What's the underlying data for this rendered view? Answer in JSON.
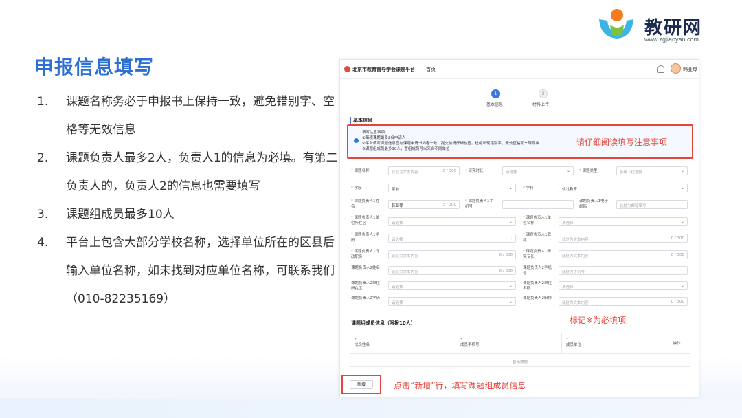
{
  "logo": {
    "name": "教研网",
    "url": "www.zgjiaoyan.com"
  },
  "page_title": "申报信息填写",
  "instructions": [
    {
      "num": "1.",
      "text": "课题名称务必于申报书上保持一致，避免错别字、空格等无效信息"
    },
    {
      "num": "2.",
      "text": "课题负责人最多2人，负责人1的信息为必填。有第二负责人的，负责人2的信息也需要填写"
    },
    {
      "num": "3.",
      "text": "课题组成员最多10人"
    },
    {
      "num": "4.",
      "text": "平台上包含大部分学校名称，选择单位所在的区县后输入单位名称，如未找到对应单位名称，可联系我们（010-82235169）"
    }
  ],
  "app": {
    "brand": "北京市教育督导学会课题平台",
    "nav_home": "首页",
    "user_name": "韩亚琴",
    "steps": [
      {
        "num": "1",
        "label": "基本信息"
      },
      {
        "num": "2",
        "label": "材料上传"
      }
    ],
    "section_title": "基本信息",
    "notice": {
      "heading": "填写注意事项:",
      "lines": [
        "①每项课题最多2名申请人",
        "②平台填写课题信息应与课题申请书内容一致，提交前请仔细核查，杜绝出现错别字、无效空格而车等现象",
        "③课题组成员最多10人，暂组成员可以来自不同单位"
      ],
      "callout": "请仔细阅读填写注意事项"
    },
    "form": {
      "r1": {
        "name_label": "课题名称",
        "name_ph": "此处为文本内容",
        "name_count": "0 / 300",
        "period_label": "研究时长",
        "period_ph": "请选择",
        "type_label": "课题类型",
        "type_ph": "多级下拉选择"
      },
      "r2": {
        "stage_label": "学段",
        "stage_val": "学前",
        "subject_label": "学科",
        "subject_val": "幼儿教育"
      },
      "r3": {
        "l1_label": "课题负责人1姓名",
        "l1_val": "韩亚琴",
        "l1_count": "3 / 300",
        "phone_label": "课题负责人1手机号",
        "email_label": "课题负责人1电子邮箱",
        "email_ph": "此处为邮箱填写"
      },
      "r4": {
        "district_label": "课题负责人1单位所在区",
        "district_ph": "请选择",
        "unit_label": "课题负责人1单位名称",
        "unit_ph": "请选择"
      },
      "r5": {
        "edu_label": "课题负责人1学历",
        "edu_ph": "请选择",
        "title_label": "课题负责人1职称",
        "title_ph": "此处为文本内容",
        "title_count": "0 / 300"
      },
      "r6": {
        "post_label": "课题负责人1行政职务",
        "post_ph": "此处为文本内容",
        "post_count": "0 / 300",
        "spec_label": "课题负责人1研究专长",
        "spec_ph": "此处为文本内容",
        "spec_count": "0 / 300"
      },
      "r7": {
        "l2_label": "课题负责人2姓名",
        "l2_ph": "此处为文本内容",
        "l2_count": "0 / 300",
        "l2phone_label": "课题负责人2手机号",
        "l2phone_ph": "此处为手机号"
      },
      "r8": {
        "l2district_label": "课题负责人2单位所在区",
        "l2district_ph": "请选择",
        "l2unit_label": "课题负责人2单位名称",
        "l2unit_ph": "请选择"
      },
      "r9": {
        "l2edu_label": "课题负责人2学历",
        "l2edu_ph": "请选择",
        "l2title_label": "课题负责人2职称",
        "l2title_ph": "此处为文本内容",
        "l2title_count": "0 / 300"
      }
    },
    "members": {
      "title": "课题组成员信息（限报10人）",
      "callout": "标记※为必填项",
      "columns": [
        "成员姓名",
        "成员手机号",
        "成员单位",
        "操作"
      ],
      "empty": "暂无数据",
      "add_label": "新增",
      "add_callout": "点击“新增”行，填写课题组成员信息"
    }
  },
  "colors": {
    "accent": "#2e6fd6",
    "highlight": "#e6453b"
  }
}
